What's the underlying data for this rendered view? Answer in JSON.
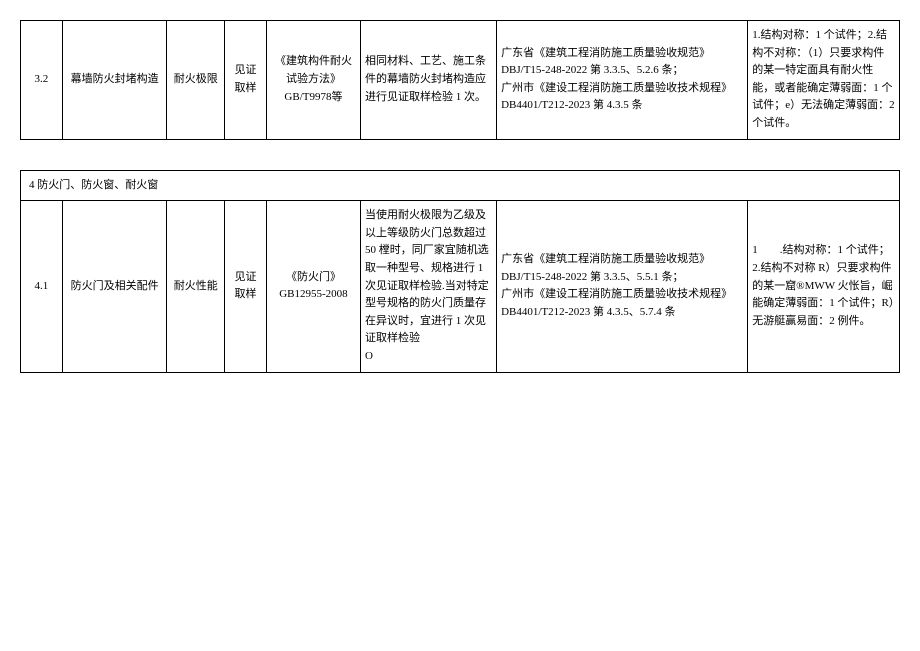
{
  "table1": {
    "rows": [
      {
        "num": "3.2",
        "name": "幕墙防火封堵构造",
        "prop": "耐火极限",
        "method": "见证取样",
        "standard": "《建筑构件耐火试验方法》GB/T9978等",
        "sampling": "相同材料、工艺、施工条件的幕墙防火封堵构造应进行见证取样检验 1 次。",
        "basis": "广东省《建筑工程消防施工质量验收规范》DBJ/T15-248-2022 第 3.3.5、5.2.6 条；\n广州市《建设工程消防施工质量验收技术规程》DB4401/T212-2023 第 4.3.5 条",
        "note": "1.结构对称：1 个试件；2.结构不对称：（1）只要求构件的某一特定面具有耐火性能，或者能确定薄弱面：1 个试件；e）无法确定薄弱面：2 个试件。"
      }
    ]
  },
  "table2": {
    "sectionTitle": "4 防火门、防火窗、耐火窗",
    "rows": [
      {
        "num": "4.1",
        "name": "防火门及相关配件",
        "prop": "耐火性能",
        "method": "见证取样",
        "standard": "《防火门》GB12955-2008",
        "sampling": "当使用耐火极限为乙级及以上等级防火门总数超过50 樘时，同厂家宜随机选取一种型号、规格进行 1 次见证取样检验.当对特定型号规格的防火门质量存在异议时，宜进行 1 次见证取样检验\nO",
        "basis": "广东省《建筑工程消防施工质量验收规范》DBJ/T15-248-2022 第 3.3.5、5.5.1 条；\n广州市《建设工程消防施工质量验收技术规程》DB4401/T212-2023 第 4.3.5、5.7.4 条",
        "note": "1　　.结构对称：1 个试件；\n2.结构不对称 R）只要求构件的某一窟®MWW 火怅旨，崛能确定薄弱面：1 个试件；R）无游艇赢易面：2 例件。"
      }
    ]
  }
}
